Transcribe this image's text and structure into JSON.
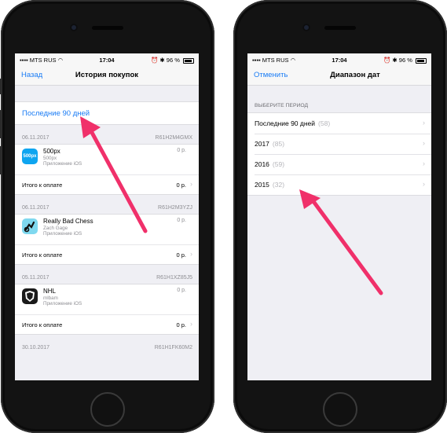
{
  "left_phone": {
    "status": {
      "carrier": "MTS RUS",
      "time": "17:04",
      "battery": "96 %"
    },
    "nav": {
      "back_label": "Назад",
      "title": "История покупок"
    },
    "filter_label": "Последние 90 дней",
    "purchases": [
      {
        "date": "06.11.2017",
        "order_id": "R61H2M4GMX",
        "app_name": "500px",
        "developer": "500px",
        "type": "Приложение iOS",
        "price": "0 р.",
        "total_label": "Итого к оплате",
        "total": "0 р.",
        "icon_text": "500px"
      },
      {
        "date": "06.11.2017",
        "order_id": "R61H2M3YZJ",
        "app_name": "Really Bad Chess",
        "developer": "Zach Gage",
        "type": "Приложение iOS",
        "price": "0 р.",
        "total_label": "Итого к оплате",
        "total": "0 р.",
        "icon_text": ""
      },
      {
        "date": "05.11.2017",
        "order_id": "R61H1XZ85J5",
        "app_name": "NHL",
        "developer": "mlbam",
        "type": "Приложение iOS",
        "price": "0 р.",
        "total_label": "Итого к оплате",
        "total": "0 р.",
        "icon_text": ""
      }
    ],
    "last_header": {
      "date": "30.10.2017",
      "order_id": "R61H1FK60M2"
    }
  },
  "right_phone": {
    "status": {
      "carrier": "MTS RUS",
      "time": "17:04",
      "battery": "96 %"
    },
    "nav": {
      "cancel_label": "Отменить",
      "title": "Диапазон дат"
    },
    "section_label": "ВЫБЕРИТЕ ПЕРИОД",
    "periods": [
      {
        "label": "Последние 90 дней",
        "count": "(58)"
      },
      {
        "label": "2017",
        "count": "(85)"
      },
      {
        "label": "2016",
        "count": "(59)"
      },
      {
        "label": "2015",
        "count": "(32)"
      }
    ]
  },
  "colors": {
    "accent": "#1a7cf5",
    "arrow": "#f0306a"
  }
}
